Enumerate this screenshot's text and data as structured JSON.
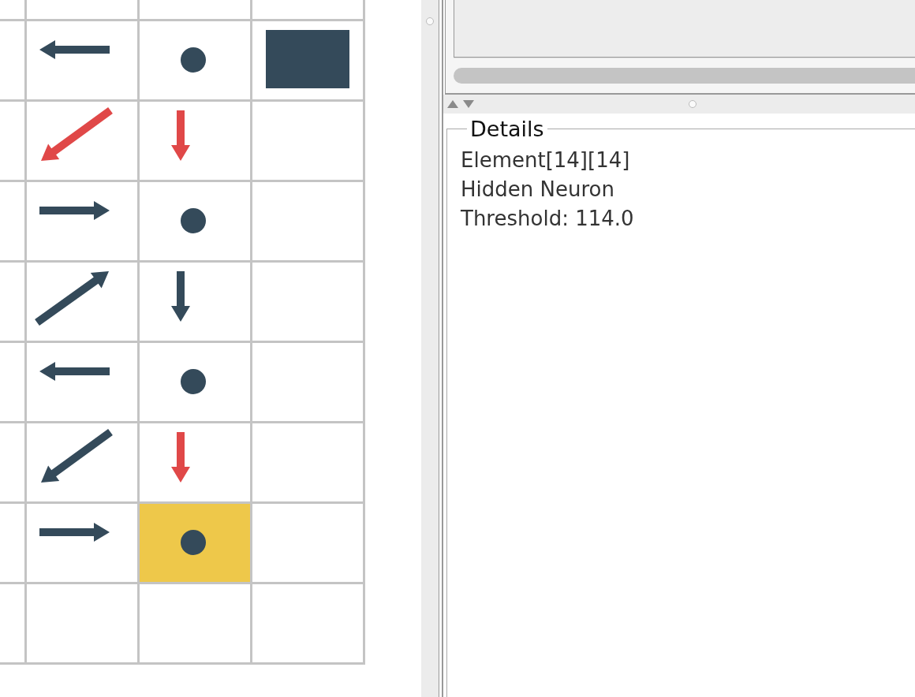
{
  "grid": {
    "rows": [
      {
        "cells": [
          {
            "kind": "arrow-left",
            "color": "#344a5a",
            "selected": false
          },
          {
            "kind": "dot",
            "color": "#344a5a",
            "selected": false
          },
          {
            "kind": "block",
            "color": "#344a5a",
            "selected": false
          }
        ]
      },
      {
        "cells": [
          {
            "kind": "arrow-down-left",
            "color": "#e04848",
            "selected": false
          },
          {
            "kind": "arrow-down",
            "color": "#e04848",
            "selected": false
          },
          {
            "kind": "empty",
            "selected": false
          }
        ]
      },
      {
        "cells": [
          {
            "kind": "arrow-right",
            "color": "#344a5a",
            "selected": false
          },
          {
            "kind": "dot",
            "color": "#344a5a",
            "selected": false
          },
          {
            "kind": "empty",
            "selected": false
          }
        ]
      },
      {
        "cells": [
          {
            "kind": "arrow-up-right",
            "color": "#344a5a",
            "selected": false
          },
          {
            "kind": "arrow-down",
            "color": "#344a5a",
            "selected": false
          },
          {
            "kind": "empty",
            "selected": false
          }
        ]
      },
      {
        "cells": [
          {
            "kind": "arrow-left",
            "color": "#344a5a",
            "selected": false
          },
          {
            "kind": "dot",
            "color": "#344a5a",
            "selected": false
          },
          {
            "kind": "empty",
            "selected": false
          }
        ]
      },
      {
        "cells": [
          {
            "kind": "arrow-down-left",
            "color": "#344a5a",
            "selected": false
          },
          {
            "kind": "arrow-down",
            "color": "#e04848",
            "selected": false
          },
          {
            "kind": "empty",
            "selected": false
          }
        ]
      },
      {
        "cells": [
          {
            "kind": "arrow-right",
            "color": "#344a5a",
            "selected": false
          },
          {
            "kind": "dot",
            "color": "#344a5a",
            "selected": true
          },
          {
            "kind": "empty",
            "selected": false
          }
        ]
      },
      {
        "cells": [
          {
            "kind": "empty",
            "selected": false
          },
          {
            "kind": "empty",
            "selected": false
          },
          {
            "kind": "empty",
            "selected": false
          }
        ]
      }
    ]
  },
  "details": {
    "title": "Details",
    "lines": [
      "Element[14][14]",
      "Hidden Neuron",
      "Threshold: 114.0"
    ]
  }
}
